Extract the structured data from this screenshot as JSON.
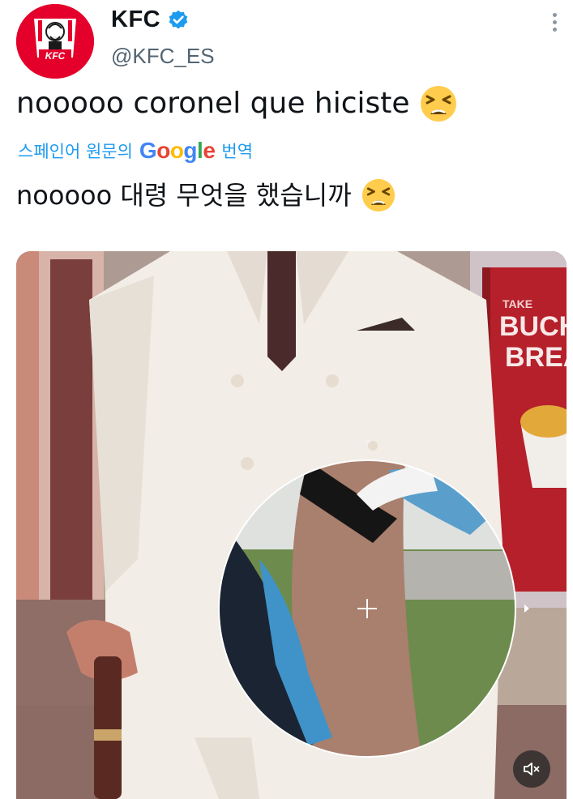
{
  "account": {
    "name": "KFC",
    "handle": "@KFC_ES",
    "avatar_text": "KFC"
  },
  "tweet": {
    "text": "nooooo coronel que hiciste",
    "emoji": "tired-face",
    "translation_prefix": "스페인어 원문의",
    "translation_brand": "Google",
    "translation_suffix": "번역",
    "translated_text": "nooooo 대령 무엇을 했습니까"
  },
  "media": {
    "sign_top": "TAKE",
    "sign_line1": "BUCH",
    "sign_line2": "BREA"
  },
  "colors": {
    "accent": "#1d9bf0",
    "brand_red": "#e4002b",
    "text_secondary": "#536471"
  }
}
